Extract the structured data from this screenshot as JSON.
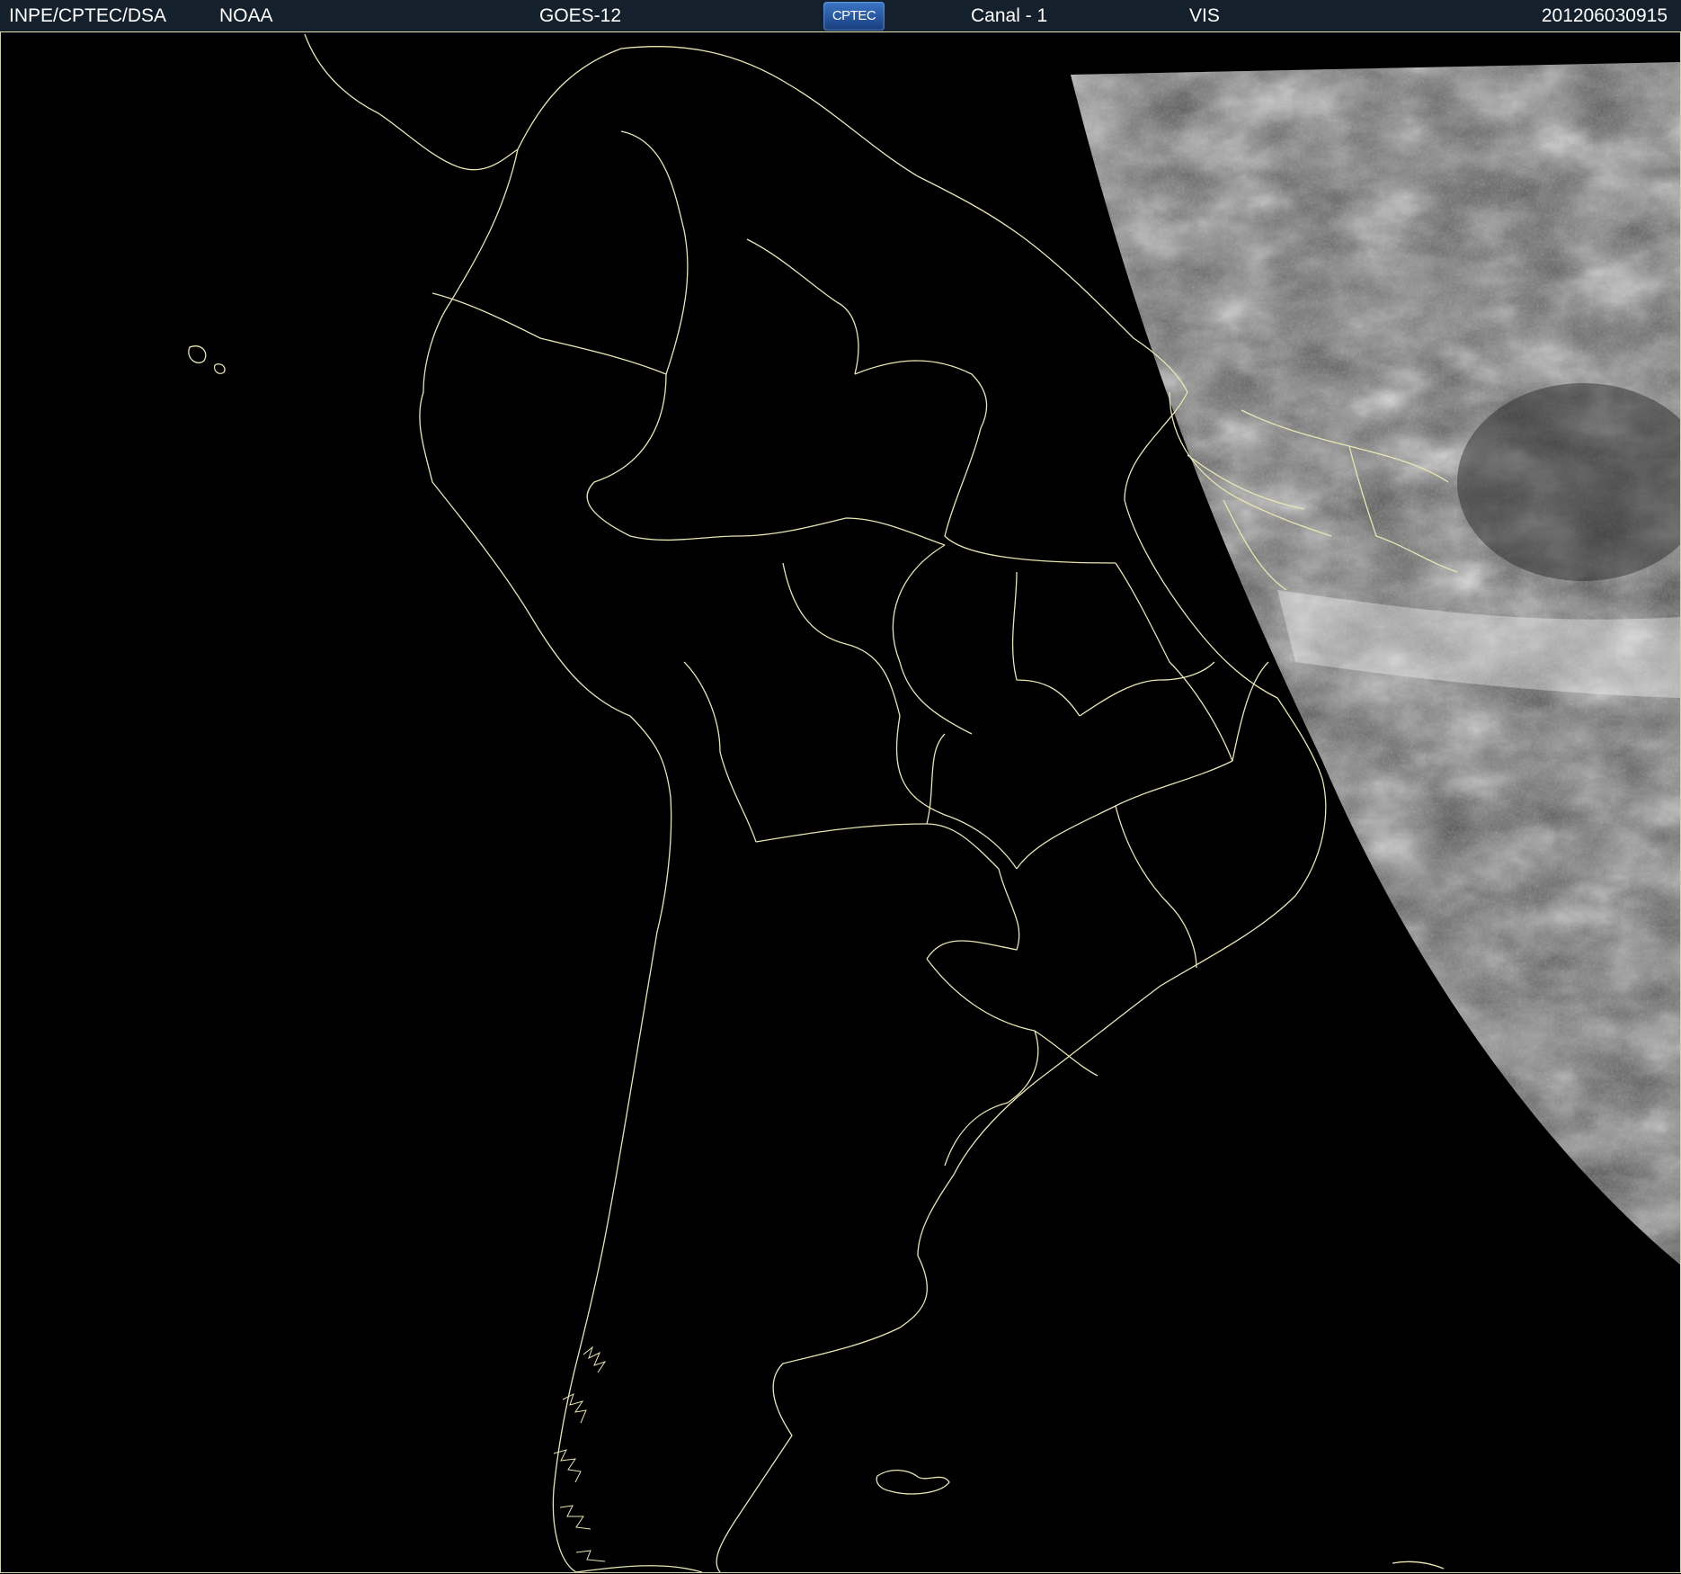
{
  "header": {
    "organization": "INPE/CPTEC/DSA",
    "agency": "NOAA",
    "satellite": "GOES-12",
    "logo_text": "CPTEC",
    "channel": "Canal - 1",
    "band": "VIS",
    "timestamp": "201206030915"
  },
  "map": {
    "subject": "South America",
    "boundary_color": "#e8e6b0",
    "space_color": "#000000",
    "illuminated_region": "east (sunlit Atlantic and eastern Brazil)",
    "image_tone": "grayscale visible reflectance"
  }
}
